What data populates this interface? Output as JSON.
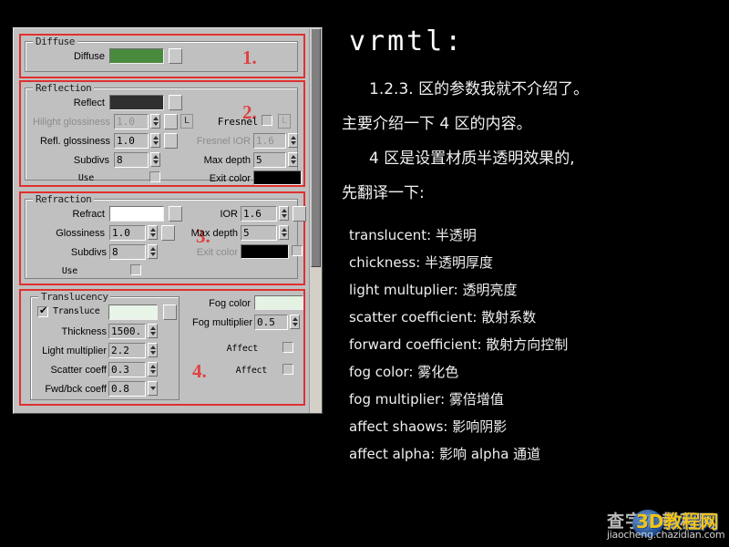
{
  "panel": {
    "scrollbar": {
      "name": "vertical-scrollbar"
    },
    "markers": {
      "one": "1.",
      "two": "2.",
      "three": "3.",
      "four": "4."
    },
    "diffuse": {
      "group_title": "Diffuse",
      "label": "Diffuse",
      "color": "#4a8a3c",
      "map_button": ""
    },
    "reflection": {
      "group_title": "Reflection",
      "reflect_label": "Reflect",
      "reflect_color": "#303030",
      "hilight_gloss_label": "Hilight glossiness",
      "hilight_gloss_value": "1.0",
      "hilight_gloss_L": "L",
      "refl_gloss_label": "Refl. glossiness",
      "refl_gloss_value": "1.0",
      "subdivs_label": "Subdivs",
      "subdivs_value": "8",
      "use_label": "Use",
      "fresnel_label": "Fresnel",
      "fresnel_L": "L",
      "fresnel_ior_label": "Fresnel IOR",
      "fresnel_ior_value": "1.6",
      "max_depth_label": "Max depth",
      "max_depth_value": "5",
      "exit_color_label": "Exit color",
      "exit_color": "#000000"
    },
    "refraction": {
      "group_title": "Refraction",
      "refract_label": "Refract",
      "refract_color": "#ffffff",
      "glossiness_label": "Glossiness",
      "glossiness_value": "1.0",
      "subdivs_label": "Subdivs",
      "subdivs_value": "8",
      "use_label": "Use",
      "ior_label": "IOR",
      "ior_value": "1.6",
      "max_depth_label": "Max depth",
      "max_depth_value": "5",
      "exit_color_label": "Exit color",
      "exit_color": "#000000"
    },
    "translucency": {
      "group_title": "Translucency",
      "translucent_label": "Transluce",
      "translucent_color": "#e8f5e8",
      "thickness_label": "Thickness",
      "thickness_value": "1500.",
      "light_multiplier_label": "Light multiplier",
      "light_multiplier_value": "2.2",
      "scatter_coeff_label": "Scatter coeff",
      "scatter_coeff_value": "0.3",
      "fwd_bck_coeff_label": "Fwd/bck coeff",
      "fwd_bck_coeff_value": "0.8",
      "fog_color_label": "Fog color",
      "fog_color": "#e3f2e3",
      "fog_multiplier_label": "Fog multiplier",
      "fog_multiplier_value": "0.5",
      "affect_shadows_label": "Affect",
      "affect_alpha_label": "Affect"
    }
  },
  "article": {
    "title": "vrmtl:",
    "paragraphs": [
      "1.2.3. 区的参数我就不介绍了。",
      "主要介绍一下 4 区的内容。",
      "4 区是设置材质半透明效果的,",
      "先翻译一下:"
    ],
    "translations": [
      "translucent: 半透明",
      "chickness: 半透明厚度",
      "light multuplier: 透明亮度",
      "scatter coefficient: 散射系数",
      "forward coefficient: 散射方向控制",
      "fog color: 雾化色",
      "fog multiplier: 雾倍增值",
      "affect shaows: 影响阴影",
      "affect alpha: 影响 alpha 通道"
    ]
  },
  "watermark": {
    "site_cn": "查字典教程网",
    "site_url": "jiaocheng.chazidian.com",
    "logo": "3D教程网"
  }
}
